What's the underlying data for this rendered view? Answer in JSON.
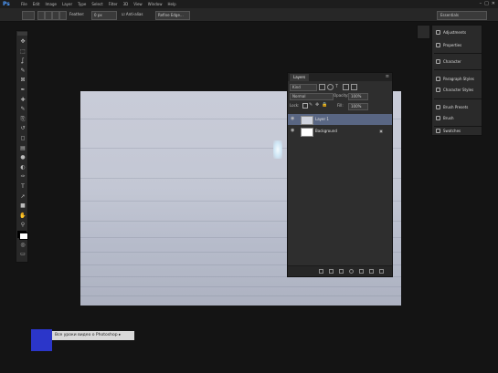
{
  "menubar": {
    "logo": "Ps",
    "items": [
      "File",
      "Edit",
      "Image",
      "Layer",
      "Type",
      "Select",
      "Filter",
      "3D",
      "View",
      "Window",
      "Help"
    ],
    "window_controls": [
      "–",
      "□",
      "✕"
    ]
  },
  "options": {
    "feather_label": "Feather:",
    "feather_value": "0 px",
    "antialias_label": "Anti-alias",
    "refine_label": "Refine Edge...",
    "workspace": "Essentials"
  },
  "toolbar": {
    "tools": [
      "move-tool",
      "marquee-tool",
      "lasso-tool",
      "quick-select-tool",
      "crop-tool",
      "eyedropper-tool",
      "healing-tool",
      "brush-tool",
      "clone-tool",
      "history-brush-tool",
      "eraser-tool",
      "gradient-tool",
      "blur-tool",
      "dodge-tool",
      "pen-tool",
      "type-tool",
      "path-select-tool",
      "shape-tool",
      "hand-tool",
      "zoom-tool",
      "foreground-color",
      "quick-mask",
      "screen-mode"
    ],
    "glyphs": [
      "✥",
      "⬚",
      "ʆ",
      "✎",
      "⊠",
      "✒",
      "✚",
      "✎",
      "⎘",
      "↺",
      "◻",
      "▤",
      "●",
      "◐",
      "✑",
      "T",
      "➚",
      "■",
      "✋",
      "⚲",
      "◩",
      "◎",
      "▭"
    ]
  },
  "dock": {
    "items": [
      {
        "label": "Adjustments",
        "icon": "adjustments-icon"
      },
      {
        "label": "Properties",
        "icon": "properties-icon"
      },
      {
        "label": "Character",
        "icon": "character-icon"
      },
      {
        "label": "Paragraph Styles",
        "icon": "paragraph-styles-icon"
      },
      {
        "label": "Character Styles",
        "icon": "character-styles-icon"
      },
      {
        "label": "Brush Presets",
        "icon": "brush-presets-icon"
      },
      {
        "label": "Brush",
        "icon": "brush-icon"
      },
      {
        "label": "Swatches",
        "icon": "swatches-icon"
      }
    ]
  },
  "layers_panel": {
    "tab": "Layers",
    "kind_label": "Kind",
    "blend_mode": "Normal",
    "opacity_label": "Opacity:",
    "opacity_value": "100%",
    "lock_label": "Lock:",
    "fill_label": "Fill:",
    "fill_value": "100%",
    "layers": [
      {
        "name": "Layer 1",
        "selected": true
      },
      {
        "name": "Background",
        "selected": false
      }
    ]
  },
  "tooltip": {
    "text": "Все уроки видео о Photoshop ▸"
  }
}
